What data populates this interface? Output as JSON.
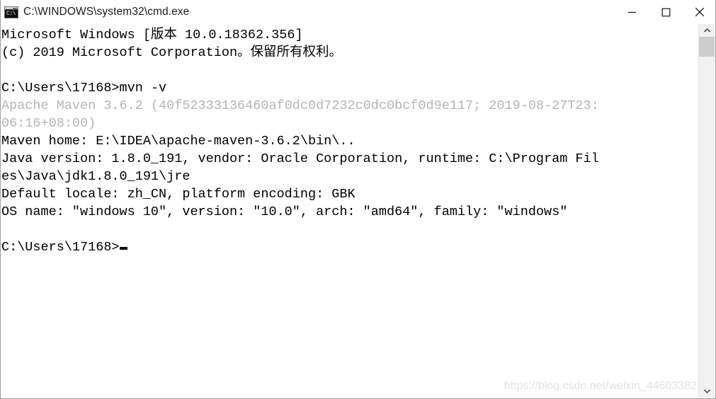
{
  "window": {
    "title": "C:\\WINDOWS\\system32\\cmd.exe",
    "icon": "cmd-console-icon",
    "icon_text": "C:\\",
    "border_color": "#9c9c9c",
    "background": "#ffffff"
  },
  "title_buttons": {
    "minimize_label": "Minimize",
    "maximize_label": "Maximize",
    "close_label": "Close"
  },
  "console": {
    "text_color": "#000000",
    "dim_color": "#b4b4b4",
    "cursor": "block-underscore-cursor",
    "lines": [
      {
        "text": "Microsoft Windows [版本 10.0.18362.356]",
        "style": "normal"
      },
      {
        "text": "(c) 2019 Microsoft Corporation。保留所有权利。",
        "style": "normal"
      },
      {
        "text": "",
        "style": "blank"
      },
      {
        "text": "C:\\Users\\17168>mvn -v",
        "style": "normal"
      },
      {
        "text": "Apache Maven 3.6.2 (40f52333136460af0dc0d7232c0dc0bcf0d9e117; 2019-08-27T23:",
        "style": "dim"
      },
      {
        "text": "06:16+08:00)",
        "style": "dim"
      },
      {
        "text": "Maven home: E:\\IDEA\\apache-maven-3.6.2\\bin\\..",
        "style": "normal"
      },
      {
        "text": "Java version: 1.8.0_191, vendor: Oracle Corporation, runtime: C:\\Program Fil",
        "style": "normal"
      },
      {
        "text": "es\\Java\\jdk1.8.0_191\\jre",
        "style": "normal"
      },
      {
        "text": "Default locale: zh_CN, platform encoding: GBK",
        "style": "normal"
      },
      {
        "text": "OS name: \"windows 10\", version: \"10.0\", arch: \"amd64\", family: \"windows\"",
        "style": "normal"
      },
      {
        "text": "",
        "style": "blank"
      },
      {
        "text": "C:\\Users\\17168>",
        "style": "prompt"
      }
    ]
  },
  "scrollbar": {
    "up_arrow": "chevron-up-icon",
    "down_arrow": "chevron-down-icon",
    "thumb_color": "#cdcdcd",
    "track_color": "#f0f0f0"
  },
  "watermark": {
    "text": "https://blog.csdn.net/weixin_44603382"
  }
}
